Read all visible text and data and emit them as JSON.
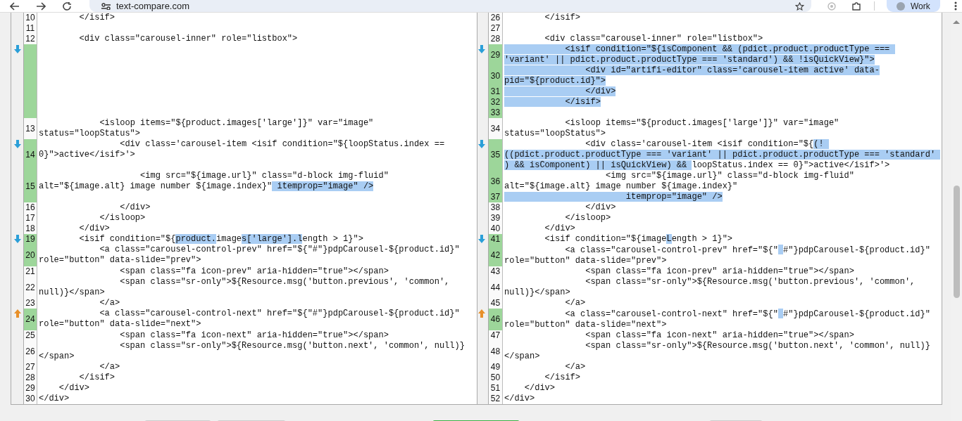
{
  "browser": {
    "url": "text-compare.com",
    "profile": "Work"
  },
  "diff": {
    "rows": [
      {
        "kind": "plain",
        "left": [
          {
            "num": "10",
            "changed": false,
            "segs": [
              {
                "text": "\t\t</isif>",
                "hl": false
              }
            ]
          }
        ],
        "right": [
          {
            "num": "26",
            "changed": false,
            "segs": [
              {
                "text": "\t\t</isif>",
                "hl": false
              }
            ]
          }
        ]
      },
      {
        "kind": "plain",
        "left": [
          {
            "num": "11",
            "changed": false
          }
        ],
        "right": [
          {
            "num": "27",
            "changed": false
          }
        ]
      },
      {
        "kind": "plain",
        "left": [
          {
            "num": "12",
            "changed": false,
            "segs": [
              {
                "text": "\t\t<div class=\"carousel-inner\" role=\"listbox\">",
                "hl": false
              }
            ]
          }
        ],
        "right": [
          {
            "num": "28",
            "changed": false,
            "segs": [
              {
                "text": "\t\t<div class=\"carousel-inner\" role=\"listbox\">",
                "hl": false
              }
            ]
          }
        ]
      },
      {
        "kind": "down",
        "left": [
          {
            "changed": true
          }
        ],
        "right": [
          {
            "num": "29",
            "changed": true,
            "segs": [
              {
                "text": "\t\t\t<isif condition=\"${isComponent && (pdict.product.productType === 'variant' || pdict.product.productType === 'standard') && !isQuickView}\">",
                "hl": true
              }
            ]
          },
          {
            "num": "30",
            "changed": true,
            "segs": [
              {
                "text": "\t\t\t\t<div id=\"artifi-editor\" class='carousel-item active' data-pid=\"${product.id}\">",
                "hl": true
              }
            ]
          },
          {
            "num": "31",
            "changed": true,
            "segs": [
              {
                "text": "\t\t\t\t</div>",
                "hl": true
              }
            ]
          },
          {
            "num": "32",
            "changed": true,
            "segs": [
              {
                "text": "\t\t\t</isif>",
                "hl": true
              }
            ]
          },
          {
            "num": "33",
            "changed": true
          }
        ]
      },
      {
        "kind": "plain",
        "left": [
          {
            "num": "13",
            "changed": false,
            "segs": [
              {
                "text": "\t\t\t<isloop items=\"${product.images['large']}\" var=\"image\" status=\"loopStatus\">",
                "hl": false
              }
            ]
          }
        ],
        "right": [
          {
            "num": "34",
            "changed": false,
            "segs": [
              {
                "text": "\t\t\t<isloop items=\"${product.images['large']}\" var=\"image\" status=\"loopStatus\">",
                "hl": false
              }
            ]
          }
        ]
      },
      {
        "kind": "down",
        "left": [
          {
            "num": "14",
            "changed": true,
            "segs": [
              {
                "text": "\t\t\t\t<div class='carousel-item <isif condition=\"${loopStatus.index == 0}\">active</isif>'>",
                "hl": false
              }
            ]
          }
        ],
        "right": [
          {
            "num": "35",
            "changed": true,
            "segs": [
              {
                "text": "\t\t\t\t<div class='carousel-item <isif condition=\"${",
                "hl": false
              },
              {
                "text": "(! ((pdict.product.productType === 'variant' || pdict.product.productType === 'standard' ) && isComponent) || isQuickView) && ",
                "hl": true
              },
              {
                "text": "loopStatus.index == 0}\">active</isif>'>",
                "hl": false
              }
            ]
          }
        ]
      },
      {
        "kind": "plain",
        "left": [
          {
            "num": "15",
            "changed": true,
            "segs": [
              {
                "text": "\t\t\t\t\t<img src=\"${image.url}\" class=\"d-block img-fluid\" alt=\"${image.alt} image number ${image.index}\"",
                "hl": false
              },
              {
                "text": " itemprop=\"image\" />",
                "hl": true
              }
            ]
          }
        ],
        "right": [
          {
            "num": "36",
            "changed": true,
            "segs": [
              {
                "text": "\t\t\t\t\t<img src=\"${image.url}\" class=\"d-block img-fluid\" alt=\"${image.alt} image number ${image.index}\"",
                "hl": false
              }
            ]
          },
          {
            "num": "37",
            "changed": true,
            "segs": [
              {
                "text": "\t\t\t\t\t\titemprop=\"image\" />",
                "hl": true
              }
            ]
          }
        ]
      },
      {
        "kind": "plain",
        "left": [
          {
            "num": "16",
            "changed": false,
            "segs": [
              {
                "text": "\t\t\t\t</div>",
                "hl": false
              }
            ]
          }
        ],
        "right": [
          {
            "num": "38",
            "changed": false,
            "segs": [
              {
                "text": "\t\t\t\t</div>",
                "hl": false
              }
            ]
          }
        ]
      },
      {
        "kind": "plain",
        "left": [
          {
            "num": "17",
            "changed": false,
            "segs": [
              {
                "text": "\t\t\t</isloop>",
                "hl": false
              }
            ]
          }
        ],
        "right": [
          {
            "num": "39",
            "changed": false,
            "segs": [
              {
                "text": "\t\t\t</isloop>",
                "hl": false
              }
            ]
          }
        ]
      },
      {
        "kind": "plain",
        "left": [
          {
            "num": "18",
            "changed": false,
            "segs": [
              {
                "text": "\t\t</div>",
                "hl": false
              }
            ]
          }
        ],
        "right": [
          {
            "num": "40",
            "changed": false,
            "segs": [
              {
                "text": "\t\t</div>",
                "hl": false
              }
            ]
          }
        ]
      },
      {
        "kind": "down",
        "left": [
          {
            "num": "19",
            "changed": true,
            "segs": [
              {
                "text": "\t\t<isif condition=\"${",
                "hl": false
              },
              {
                "text": "product.",
                "hl": true
              },
              {
                "text": "image",
                "hl": false
              },
              {
                "text": "s['large'].l",
                "hl": true
              },
              {
                "text": "ength > 1}\">",
                "hl": false
              }
            ]
          }
        ],
        "right": [
          {
            "num": "41",
            "changed": true,
            "segs": [
              {
                "text": "\t\t<isif condition=\"${image",
                "hl": false
              },
              {
                "text": "L",
                "hl": true
              },
              {
                "text": "ength > 1}\">",
                "hl": false
              }
            ]
          }
        ]
      },
      {
        "kind": "plain",
        "left": [
          {
            "num": "20",
            "changed": true,
            "segs": [
              {
                "text": "\t\t\t<a class=\"carousel-control-prev\" href=\"${\"#\"}pdpCarousel-${product.id}\" role=\"button\" data-slide=\"prev\">",
                "hl": false
              }
            ]
          }
        ],
        "right": [
          {
            "num": "42",
            "changed": true,
            "segs": [
              {
                "text": "\t\t\t<a class=\"carousel-control-prev\" href=\"${\"",
                "hl": false
              },
              {
                "kind": "gap",
                "hl": true
              },
              {
                "text": "#\"}pdpCarousel-${product.id}\" role=\"button\" data-slide=\"prev\">",
                "hl": false
              }
            ]
          }
        ]
      },
      {
        "kind": "plain",
        "left": [
          {
            "num": "21",
            "changed": false,
            "segs": [
              {
                "text": "\t\t\t\t<span class=\"fa icon-prev\" aria-hidden=\"true\"></span>",
                "hl": false
              }
            ]
          }
        ],
        "right": [
          {
            "num": "43",
            "changed": false,
            "segs": [
              {
                "text": "\t\t\t\t<span class=\"fa icon-prev\" aria-hidden=\"true\"></span>",
                "hl": false
              }
            ]
          }
        ]
      },
      {
        "kind": "plain",
        "left": [
          {
            "num": "22",
            "changed": false,
            "segs": [
              {
                "text": "\t\t\t\t<span class=\"sr-only\">${Resource.msg('button.previous', 'common', null)}</span>",
                "hl": false
              }
            ]
          }
        ],
        "right": [
          {
            "num": "44",
            "changed": false,
            "segs": [
              {
                "text": "\t\t\t\t<span class=\"sr-only\">${Resource.msg('button.previous', 'common', null)}</span>",
                "hl": false
              }
            ]
          }
        ]
      },
      {
        "kind": "plain",
        "left": [
          {
            "num": "23",
            "changed": false,
            "segs": [
              {
                "text": "\t\t\t</a>",
                "hl": false
              }
            ]
          }
        ],
        "right": [
          {
            "num": "45",
            "changed": false,
            "segs": [
              {
                "text": "\t\t\t</a>",
                "hl": false
              }
            ]
          }
        ]
      },
      {
        "kind": "up",
        "left": [
          {
            "num": "24",
            "changed": true,
            "segs": [
              {
                "text": "\t\t\t<a class=\"carousel-control-next\" href=\"${\"#\"}pdpCarousel-${product.id}\" role=\"button\" data-slide=\"next\">",
                "hl": false
              }
            ]
          }
        ],
        "right": [
          {
            "num": "46",
            "changed": true,
            "segs": [
              {
                "text": "\t\t\t<a class=\"carousel-control-next\" href=\"${\"",
                "hl": false
              },
              {
                "kind": "gap",
                "hl": true
              },
              {
                "text": "#\"}pdpCarousel-${product.id}\" role=\"button\" data-slide=\"next\">",
                "hl": false
              }
            ]
          }
        ]
      },
      {
        "kind": "plain",
        "left": [
          {
            "num": "25",
            "changed": false,
            "segs": [
              {
                "text": "\t\t\t\t<span class=\"fa icon-next\" aria-hidden=\"true\"></span>",
                "hl": false
              }
            ]
          }
        ],
        "right": [
          {
            "num": "47",
            "changed": false,
            "segs": [
              {
                "text": "\t\t\t\t<span class=\"fa icon-next\" aria-hidden=\"true\"></span>",
                "hl": false
              }
            ]
          }
        ]
      },
      {
        "kind": "plain",
        "left": [
          {
            "num": "26",
            "changed": false,
            "segs": [
              {
                "text": "\t\t\t\t<span class=\"sr-only\">${Resource.msg('button.next', 'common', null)}</span>",
                "hl": false
              }
            ]
          }
        ],
        "right": [
          {
            "num": "48",
            "changed": false,
            "segs": [
              {
                "text": "\t\t\t\t<span class=\"sr-only\">${Resource.msg('button.next', 'common', null)}</span>",
                "hl": false
              }
            ]
          }
        ]
      },
      {
        "kind": "plain",
        "left": [
          {
            "num": "27",
            "changed": false,
            "segs": [
              {
                "text": "\t\t\t</a>",
                "hl": false
              }
            ]
          }
        ],
        "right": [
          {
            "num": "49",
            "changed": false,
            "segs": [
              {
                "text": "\t\t\t</a>",
                "hl": false
              }
            ]
          }
        ]
      },
      {
        "kind": "plain",
        "left": [
          {
            "num": "28",
            "changed": false,
            "segs": [
              {
                "text": "\t\t</isif>",
                "hl": false
              }
            ]
          }
        ],
        "right": [
          {
            "num": "50",
            "changed": false,
            "segs": [
              {
                "text": "\t\t</isif>",
                "hl": false
              }
            ]
          }
        ]
      },
      {
        "kind": "plain",
        "left": [
          {
            "num": "29",
            "changed": false,
            "segs": [
              {
                "text": "\t</div>",
                "hl": false
              }
            ]
          }
        ],
        "right": [
          {
            "num": "51",
            "changed": false,
            "segs": [
              {
                "text": "\t</div>",
                "hl": false
              }
            ]
          }
        ]
      },
      {
        "kind": "plain",
        "left": [
          {
            "num": "30",
            "changed": false,
            "segs": [
              {
                "text": "</div>",
                "hl": false
              }
            ]
          }
        ],
        "right": [
          {
            "num": "52",
            "changed": false,
            "segs": [
              {
                "text": "</div>",
                "hl": false
              }
            ]
          }
        ]
      }
    ]
  }
}
